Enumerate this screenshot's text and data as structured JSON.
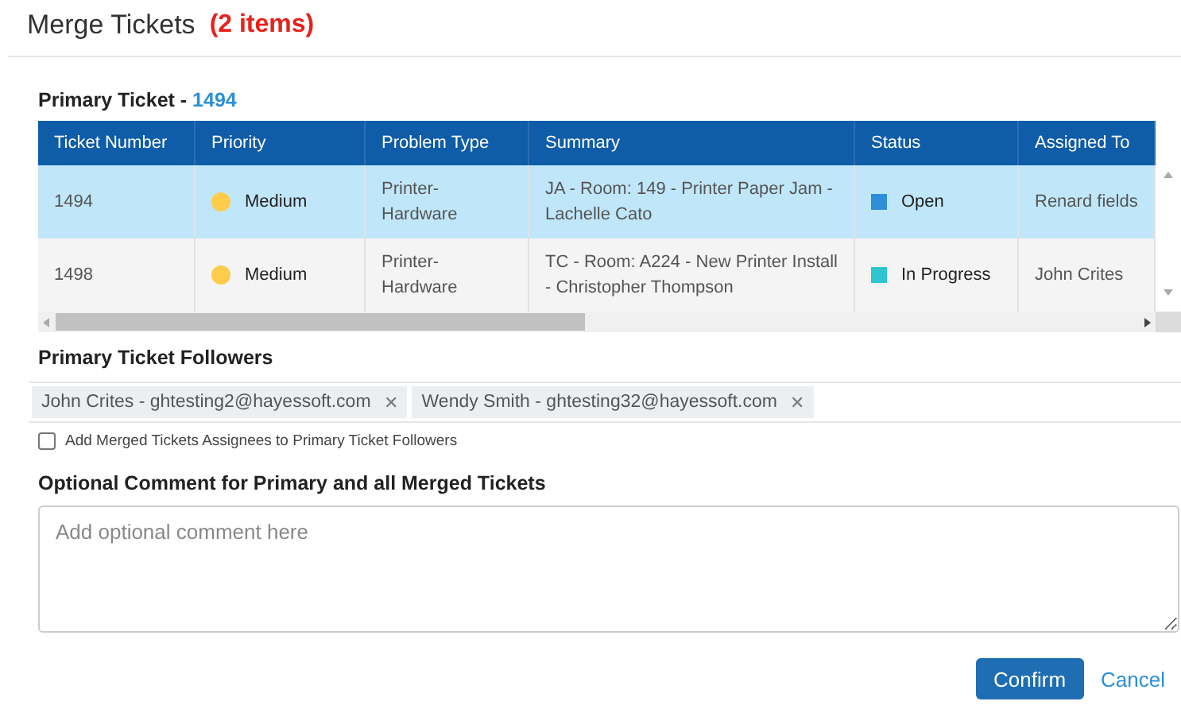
{
  "dialog": {
    "title": "Merge Tickets",
    "count": "(2 items)"
  },
  "primary": {
    "label": "Primary Ticket - ",
    "number": "1494"
  },
  "table": {
    "columns": [
      "Ticket Number",
      "Priority",
      "Problem Type",
      "Summary",
      "Status",
      "Assigned To"
    ],
    "rows": [
      {
        "selected": true,
        "number": "1494",
        "priority": {
          "label": "Medium",
          "color": "#fccc4a"
        },
        "problem_type": "Printer-Hardware",
        "summary": "JA - Room: 149 - Printer Paper Jam - Lachelle Cato",
        "status": {
          "label": "Open",
          "color": "#2f8ed8"
        },
        "assigned_to": "Renard fields"
      },
      {
        "selected": false,
        "number": "1498",
        "priority": {
          "label": "Medium",
          "color": "#fccc4a"
        },
        "problem_type": "Printer-Hardware",
        "summary": "TC - Room: A224 - New Printer Install - Christopher Thompson",
        "status": {
          "label": "In Progress",
          "color": "#2ec4d0"
        },
        "assigned_to": "John Crites"
      }
    ]
  },
  "followers": {
    "label": "Primary Ticket Followers",
    "tags": [
      "John Crites - ghtesting2@hayessoft.com",
      "Wendy Smith - ghtesting32@hayessoft.com"
    ],
    "remove_symbol": "✕"
  },
  "add_assignees": {
    "label": "Add Merged Tickets Assignees to Primary Ticket Followers",
    "checked": false
  },
  "comment": {
    "label": "Optional Comment for Primary and all Merged Tickets",
    "placeholder": "Add optional comment here"
  },
  "buttons": {
    "confirm": "Confirm",
    "cancel": "Cancel"
  }
}
